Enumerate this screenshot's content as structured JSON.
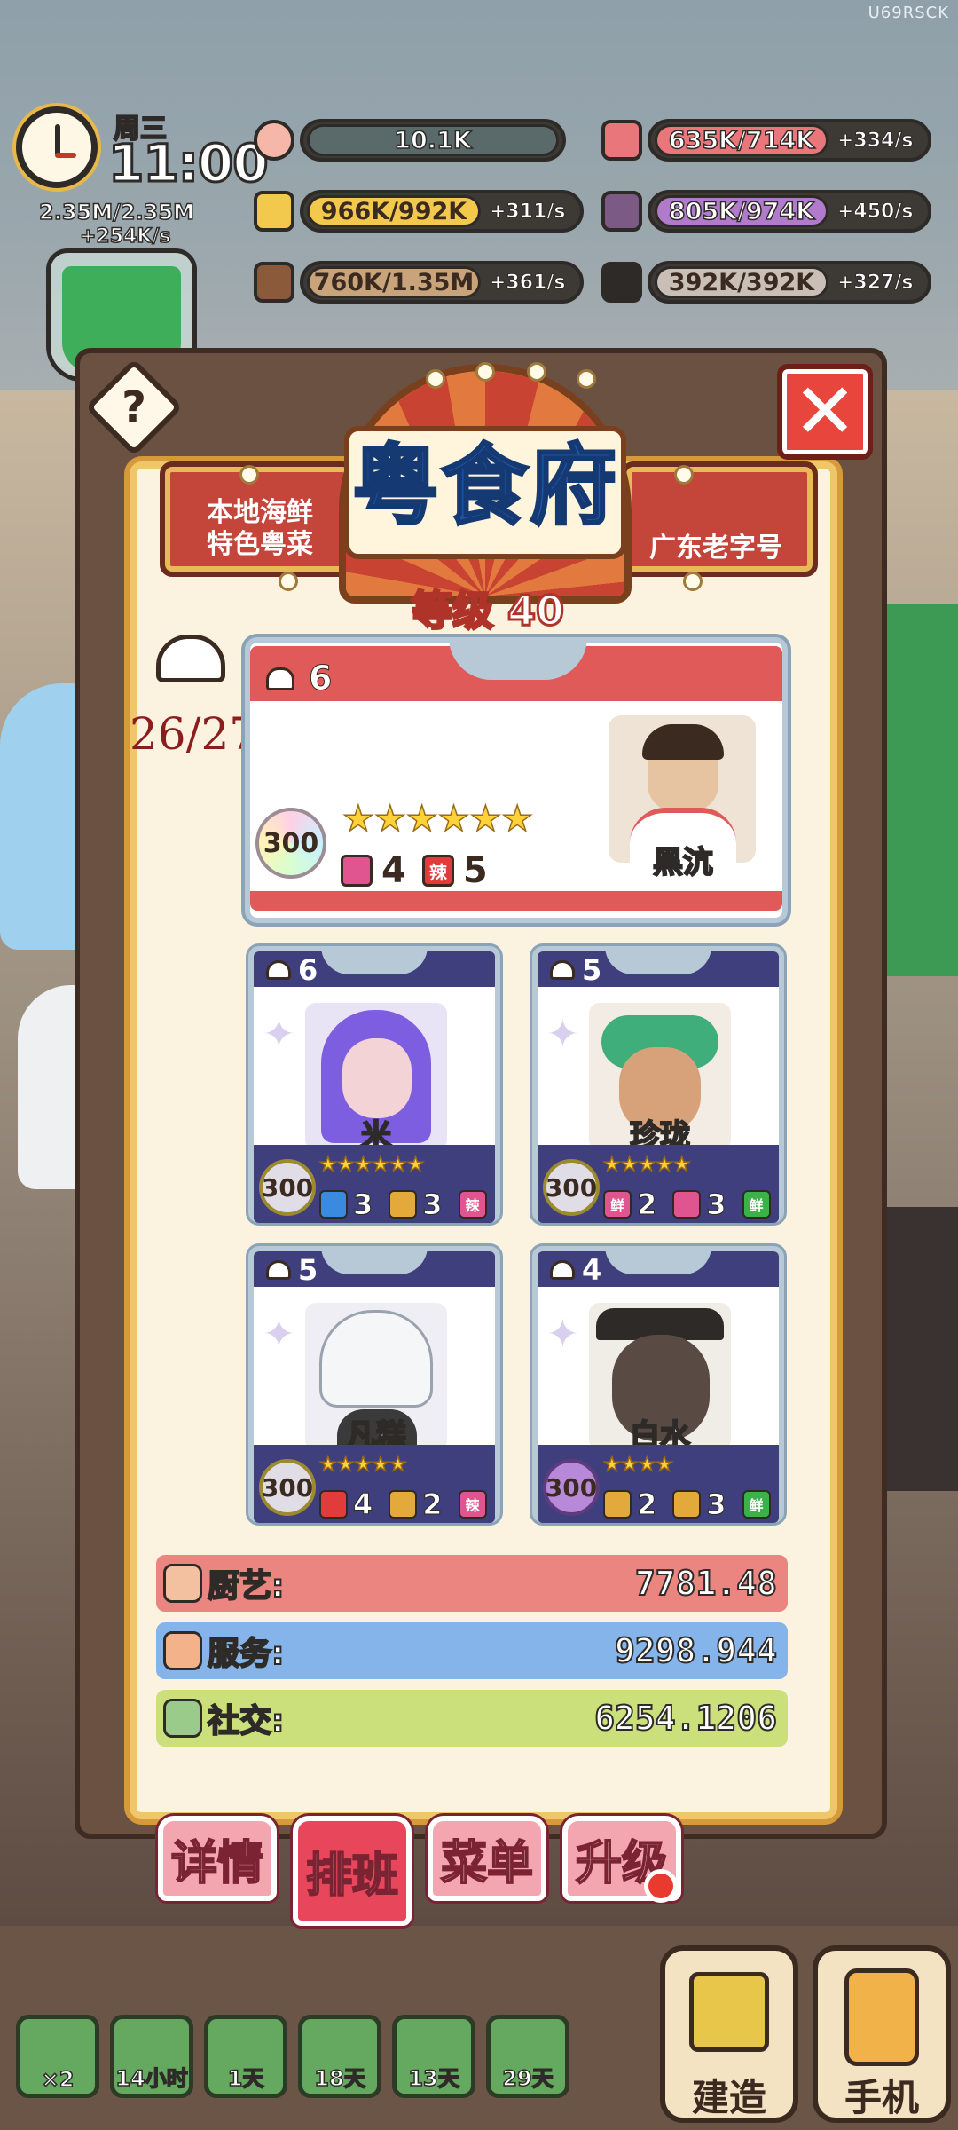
{
  "watermark": "U69RSCK",
  "hud": {
    "weekday": "周三",
    "time": "11:00",
    "money": "2.35M/2.35M",
    "money_rate": "+254K/s",
    "resources": [
      {
        "icon": "peach-icon",
        "value": "10.1K",
        "rate": "",
        "color": "#f7b7a8"
      },
      {
        "icon": "brush-icon",
        "value": "635K/714K",
        "rate": "+334/s",
        "color": "#e8767a"
      },
      {
        "icon": "gold-bar-icon",
        "value": "966K/992K",
        "rate": "+311/s",
        "color": "#f2c94c"
      },
      {
        "icon": "fabric-icon",
        "value": "805K/974K",
        "rate": "+450/s",
        "color": "#b17acb"
      },
      {
        "icon": "wood-plank-icon",
        "value": "760K/1.35M",
        "rate": "+361/s",
        "color": "#c9a37a"
      },
      {
        "icon": "coal-icon",
        "value": "392K/392K",
        "rate": "+327/s",
        "color": "#c9bfb6"
      }
    ]
  },
  "restaurant": {
    "name": "粤食府",
    "left_tag": "本地海鲜 特色粤菜",
    "left_tag_line1": "本地海鲜",
    "left_tag_line2": "特色粤菜",
    "right_tag": "广东老字号",
    "level": "等级 40",
    "seats": "26/27"
  },
  "head_chef": {
    "level": "6",
    "name": "黑沆",
    "badge": "300",
    "stars": "★★★★★★",
    "skills": [
      {
        "icon": "book-icon",
        "char": "",
        "value": "4",
        "color": "#e0548f"
      },
      {
        "icon": "spicy-icon",
        "char": "辣",
        "value": "5",
        "color": "#e23b3b"
      }
    ]
  },
  "staff": [
    {
      "level": "6",
      "name": "米",
      "badge": "300",
      "badge_style": "plain",
      "stars": "★★★★★★",
      "skills": [
        {
          "icon": "lotus-icon",
          "char": "",
          "value": "3",
          "color": "#3a8be0"
        },
        {
          "icon": "book-icon",
          "char": "",
          "value": "3",
          "color": "#e3a93a"
        },
        {
          "icon": "spicy-icon",
          "char": "辣",
          "value": "",
          "color": "#e0548f"
        }
      ]
    },
    {
      "level": "5",
      "name": "珍珑",
      "badge": "300",
      "badge_style": "plain",
      "stars": "★★★★★",
      "skills": [
        {
          "icon": "fresh-icon",
          "char": "鲜",
          "value": "2",
          "color": "#e0548f"
        },
        {
          "icon": "box-icon",
          "char": "",
          "value": "3",
          "color": "#e0548f"
        },
        {
          "icon": "fresh-icon",
          "char": "鲜",
          "value": "",
          "color": "#3bb14a"
        }
      ]
    },
    {
      "level": "5",
      "name": "凡糕",
      "badge": "300",
      "badge_style": "plain",
      "stars": "★★★★★",
      "skills": [
        {
          "icon": "lips-icon",
          "char": "",
          "value": "4",
          "color": "#e23b3b"
        },
        {
          "icon": "book-icon",
          "char": "",
          "value": "2",
          "color": "#e3a93a"
        },
        {
          "icon": "spicy-icon",
          "char": "辣",
          "value": "",
          "color": "#e0548f"
        }
      ]
    },
    {
      "level": "4",
      "name": "白水",
      "badge": "300",
      "badge_style": "purple",
      "stars": "★★★★",
      "skills": [
        {
          "icon": "smile-icon",
          "char": "",
          "value": "2",
          "color": "#e3a93a"
        },
        {
          "icon": "box-icon",
          "char": "",
          "value": "3",
          "color": "#e3a93a"
        },
        {
          "icon": "fresh-icon",
          "char": "鲜",
          "value": "",
          "color": "#3bb14a"
        }
      ]
    }
  ],
  "stats": [
    {
      "label": "厨艺:",
      "value": "7781.48",
      "color": "#ea8580",
      "icon": "utensils-icon"
    },
    {
      "label": "服务:",
      "value": "9298.944",
      "color": "#85b4ea",
      "icon": "cloche-icon"
    },
    {
      "label": "社交:",
      "value": "6254.1206",
      "color": "#cbe07a",
      "icon": "chat-icon"
    }
  ],
  "tabs": [
    "详情",
    "排班",
    "菜单",
    "升级"
  ],
  "active_tab": "排班",
  "bottom_slots": [
    "×2",
    "14小时",
    "1天",
    "18天",
    "13天",
    "29天"
  ],
  "bottom_buttons": {
    "build": "建造",
    "phone": "手机"
  }
}
